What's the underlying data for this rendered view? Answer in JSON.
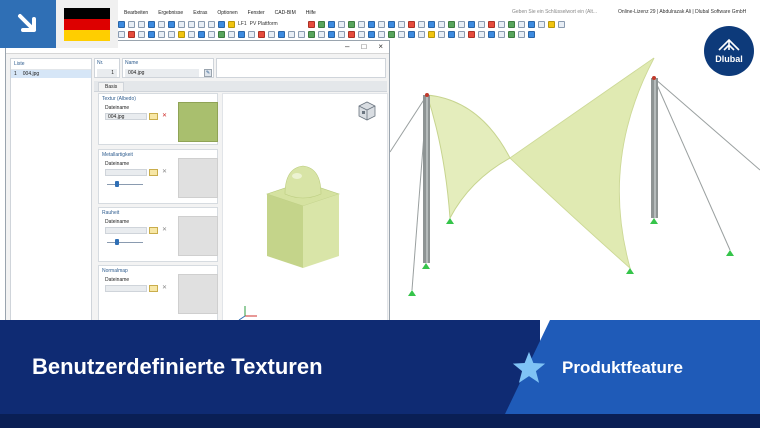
{
  "menu": {
    "items": [
      "Bearbeiten",
      "Ergebnisse",
      "Extras",
      "Optionen",
      "Fenster",
      "CAD-BIM",
      "Hilfe"
    ]
  },
  "search": {
    "placeholder": "Geben Sie ein Schlüsselwort ein (Alt..."
  },
  "license": {
    "text": "Online-Lizenz 29 | Abdulrazak Ali | Dlubal Software GmbH"
  },
  "toolbar": {
    "loadcase_code": "LF1",
    "loadcase_name": "PV Plattform"
  },
  "dialog": {
    "list_header": "Liste",
    "list_items": [
      {
        "no": "1",
        "name": "004.jpg"
      }
    ],
    "no_label": "Nr.",
    "no_value": "1",
    "name_label": "Name",
    "name_value": "004.jpg",
    "tab": "Basis",
    "groups": [
      {
        "title": "Textur (Albedo)",
        "file_label": "Dateiname",
        "file_value": "004.jpg",
        "has_slider": false
      },
      {
        "title": "Metallartigkeit",
        "file_label": "Dateiname",
        "file_value": "",
        "has_slider": true,
        "slider_fraction": 0.25
      },
      {
        "title": "Rauheit",
        "file_label": "Dateiname",
        "file_value": "",
        "has_slider": true,
        "slider_fraction": 0.25
      },
      {
        "title": "Normalmap",
        "file_label": "Dateiname",
        "file_value": "",
        "has_slider": false
      }
    ]
  },
  "colors": {
    "banner_dark": "#0f2b73",
    "banner_accent": "#1f5bb8",
    "texture_green": "#a9bf6e",
    "membrane": "#e4edbc",
    "support": "#35c44a"
  },
  "logo": {
    "text": "Dlubal"
  },
  "banner": {
    "title": "Benutzerdefinierte Texturen",
    "feature": "Produktfeature"
  }
}
